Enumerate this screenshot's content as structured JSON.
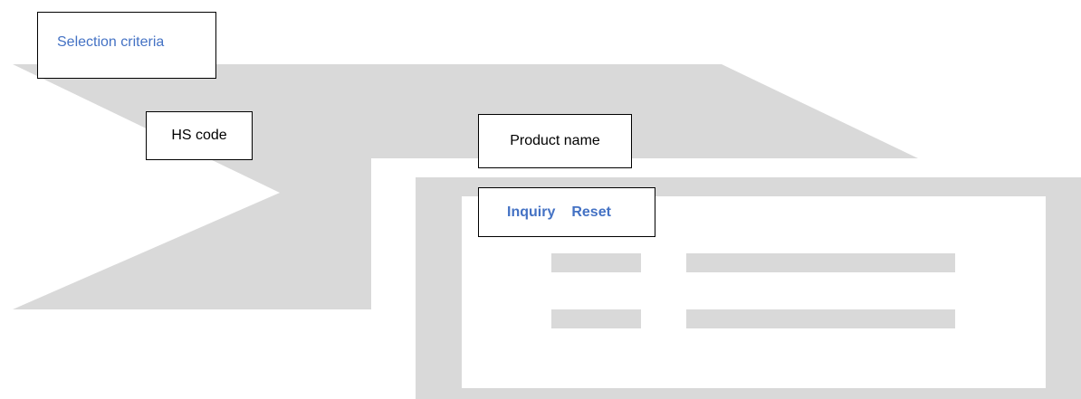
{
  "selection_criteria": {
    "title": "Selection criteria"
  },
  "fields": {
    "hs_code_label": "HS code",
    "product_name_label": "Product name"
  },
  "actions": {
    "inquiry_label": "Inquiry",
    "reset_label": "Reset"
  },
  "colors": {
    "accent_text": "#4472c4",
    "placeholder_gray": "#d9d9d9"
  }
}
